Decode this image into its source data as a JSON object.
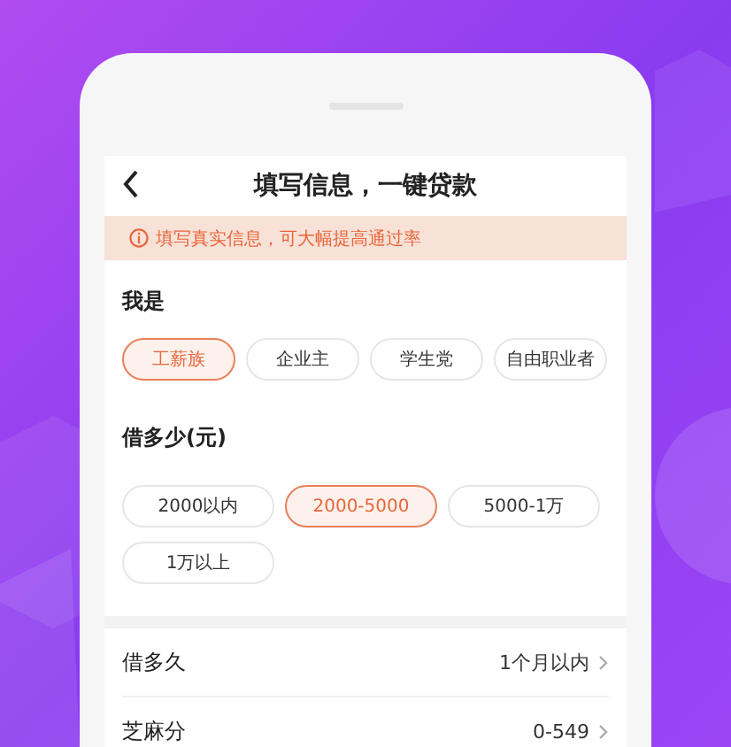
{
  "header": {
    "title": "填写信息，一键贷款"
  },
  "notice": {
    "text": "填写真实信息，可大幅提高通过率"
  },
  "identity": {
    "label": "我是",
    "options": [
      {
        "label": "工薪族",
        "selected": true
      },
      {
        "label": "企业主",
        "selected": false
      },
      {
        "label": "学生党",
        "selected": false
      },
      {
        "label": "自由职业者",
        "selected": false
      }
    ]
  },
  "amount": {
    "label": "借多少(元)",
    "options": [
      {
        "label": "2000以内",
        "selected": false
      },
      {
        "label": "2000-5000",
        "selected": true
      },
      {
        "label": "5000-1万",
        "selected": false
      },
      {
        "label": "1万以上",
        "selected": false
      }
    ]
  },
  "rows": [
    {
      "label": "借多久",
      "value": "1个月以内"
    },
    {
      "label": "芝麻分",
      "value": "0-549"
    }
  ]
}
